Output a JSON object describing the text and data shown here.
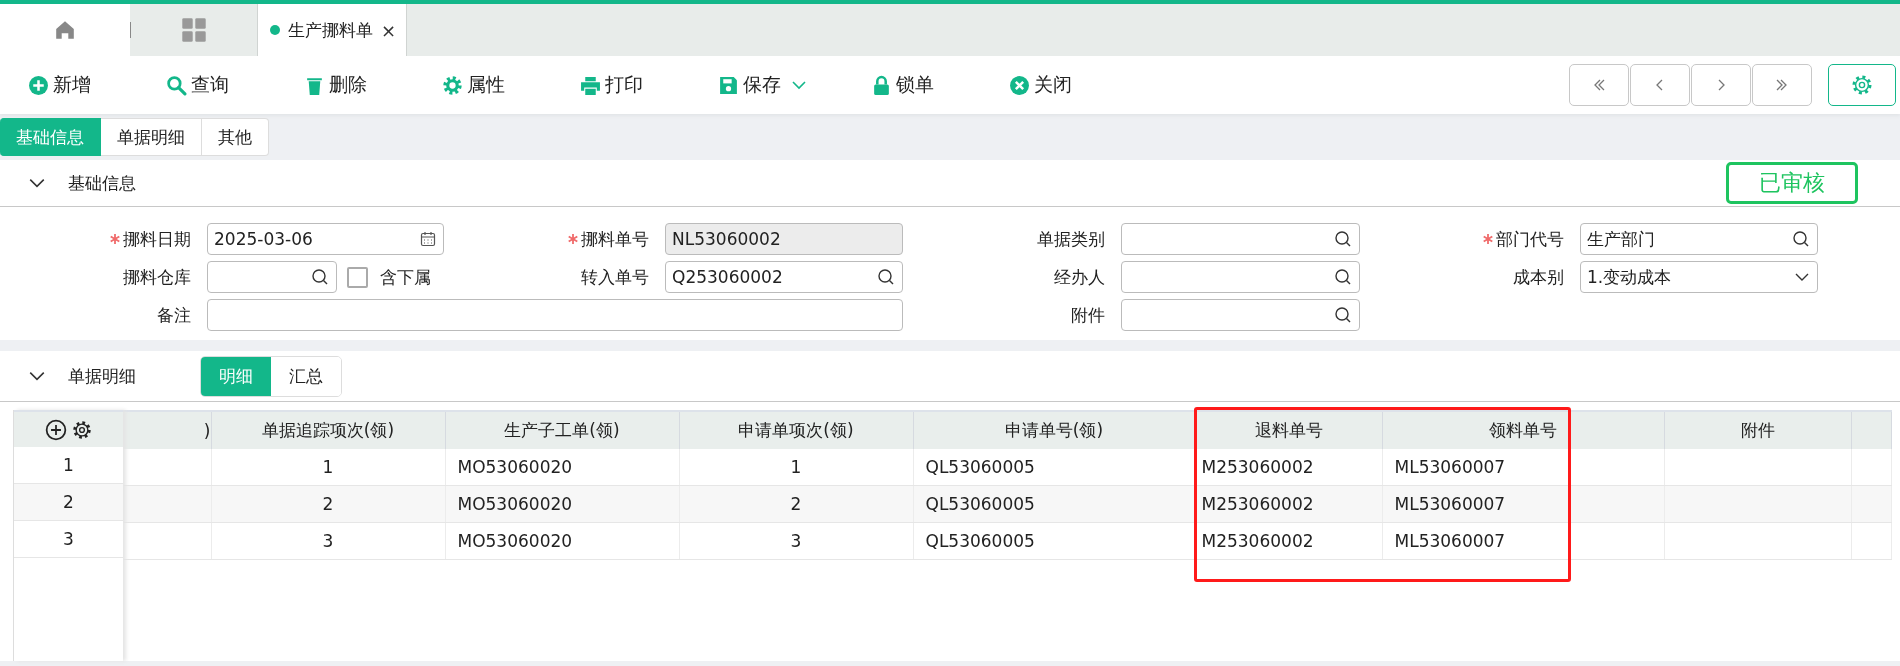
{
  "window_tabs": [
    {
      "kind": "home",
      "selected": false
    },
    {
      "kind": "apps",
      "selected": false
    },
    {
      "kind": "document",
      "label": "生产挪料单",
      "close_glyph": "×",
      "selected": true
    }
  ],
  "toolbar": [
    {
      "kind": "add",
      "label": "新增"
    },
    {
      "kind": "search",
      "label": "查询"
    },
    {
      "kind": "delete",
      "label": "删除"
    },
    {
      "kind": "properties",
      "label": "属性"
    },
    {
      "kind": "print",
      "label": "打印"
    },
    {
      "kind": "save",
      "label": "保存",
      "dropdown": true
    },
    {
      "kind": "lock",
      "label": "锁单"
    },
    {
      "kind": "close",
      "label": "关闭"
    }
  ],
  "form_tabs": [
    {
      "label": "基础信息",
      "selected": true
    },
    {
      "label": "单据明细",
      "selected": false
    },
    {
      "label": "其他",
      "selected": false
    }
  ],
  "basic_info": {
    "title": "基础信息",
    "expanded": true,
    "status_badge": "已审核",
    "rows": [
      [
        {
          "label": "挪料日期",
          "required": true,
          "kind": "date",
          "value": "2025-03-06"
        },
        {
          "label": "挪料单号",
          "required": true,
          "kind": "readonly",
          "value": "NL53060002"
        },
        {
          "label": "单据类别",
          "required": false,
          "kind": "lookup"
        },
        {
          "label": "部门代号",
          "required": true,
          "kind": "lookup",
          "value": "生产部门"
        }
      ],
      [
        {
          "label": "挪料仓库",
          "required": false,
          "kind": "lookup",
          "option": {
            "label": "含下属",
            "checked": false
          }
        },
        {
          "label": "转入单号",
          "required": false,
          "kind": "lookup",
          "value": "Q253060002"
        },
        {
          "label": "经办人",
          "required": false,
          "kind": "lookup"
        },
        {
          "label": "成本别",
          "required": false,
          "kind": "select",
          "value": "1.变动成本"
        }
      ],
      [
        {
          "label": "备注",
          "required": false,
          "kind": "wide"
        },
        "",
        {
          "label": "附件",
          "required": false,
          "kind": "lookup"
        }
      ]
    ]
  },
  "detail": {
    "title": "单据明细",
    "expanded": true,
    "views": [
      {
        "label": "明细",
        "selected": true
      },
      {
        "label": "汇总",
        "selected": false
      }
    ],
    "table": {
      "columns": [
        {
          "label": ")",
          "kind": "cut"
        },
        {
          "label": "单据追踪项次(领)",
          "kind": "count"
        },
        {
          "label": "生产子工单(领)",
          "kind": "code"
        },
        {
          "label": "申请单项次(领)",
          "kind": "count"
        },
        {
          "label": "申请单号(领)",
          "kind": "code"
        },
        {
          "label": "退料单号",
          "kind": "code"
        },
        {
          "label": "领料单号",
          "kind": "code"
        },
        {
          "label": "附件",
          "kind": "code"
        }
      ],
      "rows": [
        {
          "row_number": "1",
          "tracking_item": "1",
          "sub_work_order": "MO53060020",
          "request_item": "1",
          "request_no": "QL53060005",
          "return_no": "M253060002",
          "issue_no": "ML53060007"
        },
        {
          "row_number": "2",
          "tracking_item": "2",
          "sub_work_order": "MO53060020",
          "request_item": "2",
          "request_no": "QL53060005",
          "return_no": "M253060002",
          "issue_no": "ML53060007"
        },
        {
          "row_number": "3",
          "tracking_item": "3",
          "sub_work_order": "MO53060020",
          "request_item": "3",
          "request_no": "QL53060005",
          "return_no": "M253060002",
          "issue_no": "ML53060007"
        }
      ]
    }
  }
}
